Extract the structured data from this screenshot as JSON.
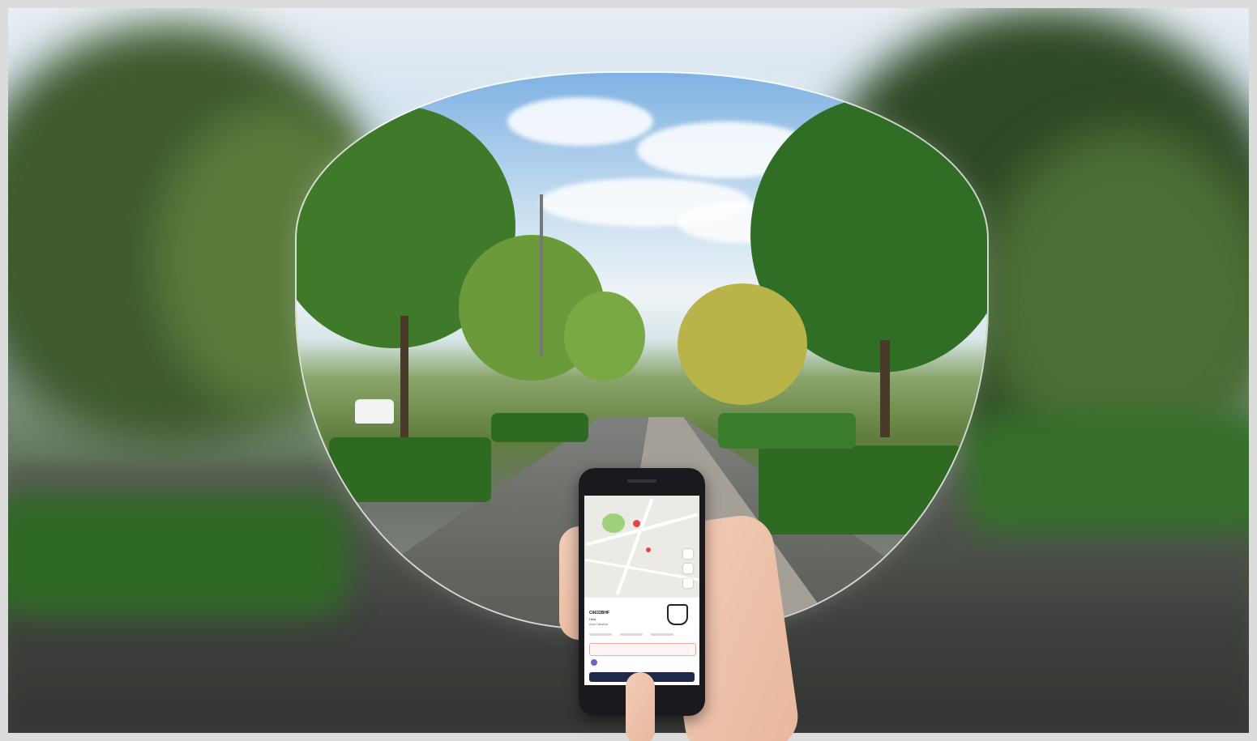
{
  "scene": {
    "description_type": "photo",
    "colors": {
      "sky": "#cfe0ee",
      "foliage": "#4f7a33",
      "road": "#5a5c58",
      "phone": "#1a1a1e",
      "accent": "#e64545"
    }
  },
  "phone": {
    "screen": {
      "plate_code": "C6632BHF",
      "line1": "Hola",
      "line2": "Ana Catalina"
    }
  }
}
